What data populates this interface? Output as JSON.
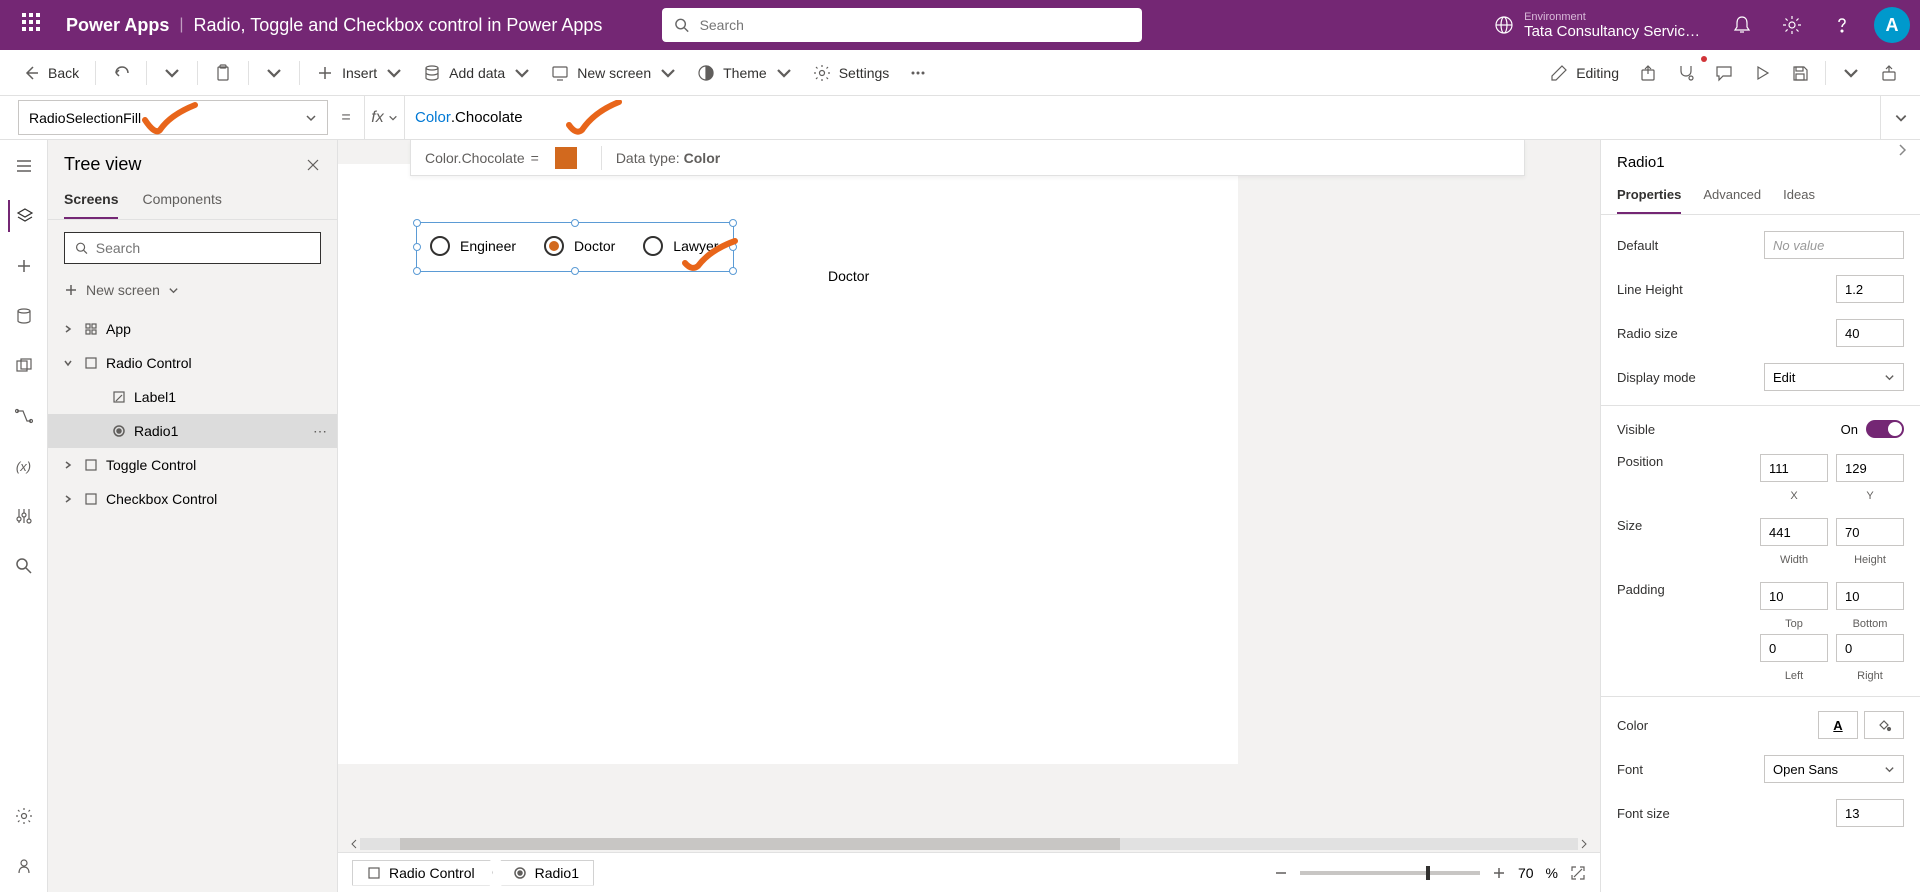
{
  "header": {
    "app_name": "Power Apps",
    "page_title": "Radio, Toggle and Checkbox control in Power Apps",
    "search_placeholder": "Search",
    "environment_label": "Environment",
    "environment_value": "Tata Consultancy Servic…",
    "avatar_initial": "A"
  },
  "toolbar": {
    "back": "Back",
    "insert": "Insert",
    "add_data": "Add data",
    "new_screen": "New screen",
    "theme": "Theme",
    "settings": "Settings",
    "editing": "Editing"
  },
  "formula": {
    "property": "RadioSelectionFill",
    "fx": "fx",
    "expr_keyword": "Color",
    "expr_rest": ".Chocolate",
    "result_label": "Color.Chocolate",
    "equals": "=",
    "datatype_label": "Data type:",
    "datatype_value": "Color",
    "color_hex": "#d2691e"
  },
  "tree": {
    "title": "Tree view",
    "tabs": {
      "screens": "Screens",
      "components": "Components"
    },
    "search_placeholder": "Search",
    "new_screen": "New screen",
    "items": [
      {
        "name": "App",
        "indent": 0,
        "expandable": true,
        "expanded": false,
        "icon": "app"
      },
      {
        "name": "Radio Control",
        "indent": 0,
        "expandable": true,
        "expanded": true,
        "icon": "screen"
      },
      {
        "name": "Label1",
        "indent": 1,
        "expandable": false,
        "icon": "label"
      },
      {
        "name": "Radio1",
        "indent": 1,
        "expandable": false,
        "icon": "radio",
        "selected": true
      },
      {
        "name": "Toggle Control",
        "indent": 0,
        "expandable": true,
        "expanded": false,
        "icon": "screen"
      },
      {
        "name": "Checkbox Control",
        "indent": 0,
        "expandable": true,
        "expanded": false,
        "icon": "screen"
      }
    ]
  },
  "canvas": {
    "radio_options": [
      "Engineer",
      "Doctor",
      "Lawyer"
    ],
    "selected_index": 1,
    "output_text": "Doctor"
  },
  "breadcrumb": {
    "screen": "Radio Control",
    "control": "Radio1",
    "zoom": "70",
    "zoom_unit": "%"
  },
  "properties": {
    "control_name": "Radio1",
    "tabs": {
      "properties": "Properties",
      "advanced": "Advanced",
      "ideas": "Ideas"
    },
    "default_label": "Default",
    "default_value": "No value",
    "line_height_label": "Line Height",
    "line_height_value": "1.2",
    "radio_size_label": "Radio size",
    "radio_size_value": "40",
    "display_mode_label": "Display mode",
    "display_mode_value": "Edit",
    "visible_label": "Visible",
    "visible_value": "On",
    "position_label": "Position",
    "position_x": "111",
    "position_y": "129",
    "x_label": "X",
    "y_label": "Y",
    "size_label": "Size",
    "size_w": "441",
    "size_h": "70",
    "width_label": "Width",
    "height_label": "Height",
    "padding_label": "Padding",
    "padding_top": "10",
    "padding_bottom": "10",
    "padding_left": "0",
    "padding_right": "0",
    "top_label": "Top",
    "bottom_label": "Bottom",
    "left_label": "Left",
    "right_label": "Right",
    "color_label": "Color",
    "font_label": "Font",
    "font_value": "Open Sans",
    "font_size_label": "Font size",
    "font_size_value": "13"
  }
}
